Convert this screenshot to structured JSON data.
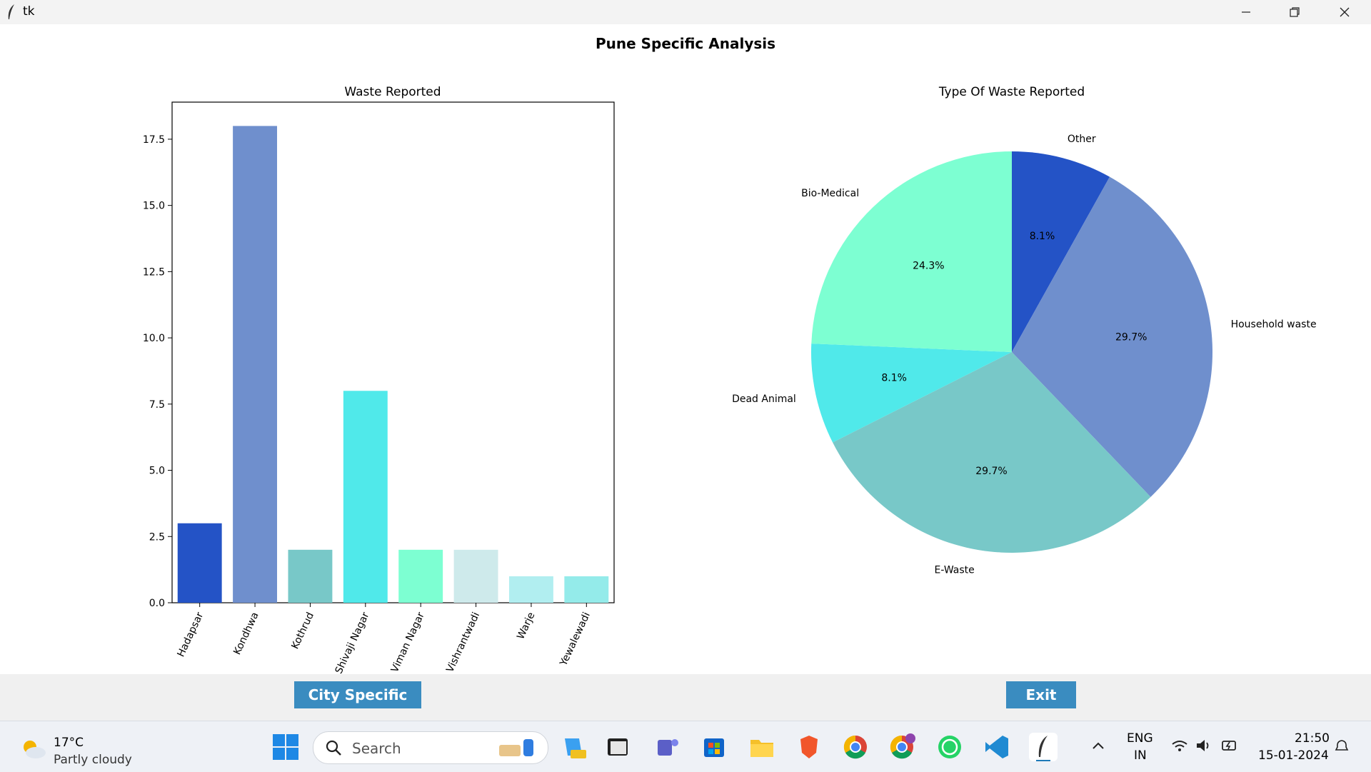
{
  "window": {
    "title": "tk"
  },
  "page": {
    "title": "Pune Specific Analysis"
  },
  "chart_data": [
    {
      "type": "bar",
      "title": "Waste Reported",
      "categories": [
        "Hadapsar",
        "Kondhwa",
        "Kothrud",
        "Shivaji Nagar",
        "Viman Nagar",
        "Vishrantwadi",
        "Warje",
        "Yewalewadi"
      ],
      "values": [
        3,
        18,
        2,
        8,
        2,
        2,
        1,
        1
      ],
      "colors": [
        "#2453c6",
        "#6f8fcd",
        "#78c8c8",
        "#50e9ea",
        "#7dffd2",
        "#ceeaeb",
        "#b1eef0",
        "#94ebea"
      ],
      "ylim": [
        0,
        18.9
      ],
      "yticks": [
        "0.0",
        "2.5",
        "5.0",
        "7.5",
        "10.0",
        "12.5",
        "15.0",
        "17.5"
      ],
      "ytick_values": [
        0,
        2.5,
        5,
        7.5,
        10,
        12.5,
        15,
        17.5
      ],
      "xlabel": "",
      "ylabel": "",
      "grid": false
    },
    {
      "type": "pie",
      "title": "Type Of Waste Reported",
      "slices": [
        {
          "label": "Other",
          "value": 8.1,
          "pct": "8.1%",
          "color": "#2453c6"
        },
        {
          "label": "Household waste",
          "value": 29.7,
          "pct": "29.7%",
          "color": "#6f8fcd"
        },
        {
          "label": "E-Waste",
          "value": 29.7,
          "pct": "29.7%",
          "color": "#78c8c8"
        },
        {
          "label": "Dead Animal",
          "value": 8.1,
          "pct": "8.1%",
          "color": "#50e9ea"
        },
        {
          "label": "Bio-Medical",
          "value": 24.3,
          "pct": "24.3%",
          "color": "#7dffd2"
        }
      ],
      "start_angle_deg": 90,
      "direction": "clockwise"
    }
  ],
  "buttons": {
    "city_specific": "City Specific",
    "exit": "Exit"
  },
  "taskbar": {
    "weather_temp": "17°C",
    "weather_desc": "Partly cloudy",
    "search_placeholder": "Search",
    "lang_top": "ENG",
    "lang_bottom": "IN",
    "time": "21:50",
    "date": "15-01-2024",
    "icons": [
      "start-icon",
      "copilot-icon",
      "terminal-icon",
      "teams-icon",
      "store-icon",
      "file-explorer-icon",
      "brave-icon",
      "chrome-icon",
      "chrome-profile-icon",
      "whatsapp-icon",
      "vscode-icon",
      "tk-feather-icon"
    ]
  }
}
